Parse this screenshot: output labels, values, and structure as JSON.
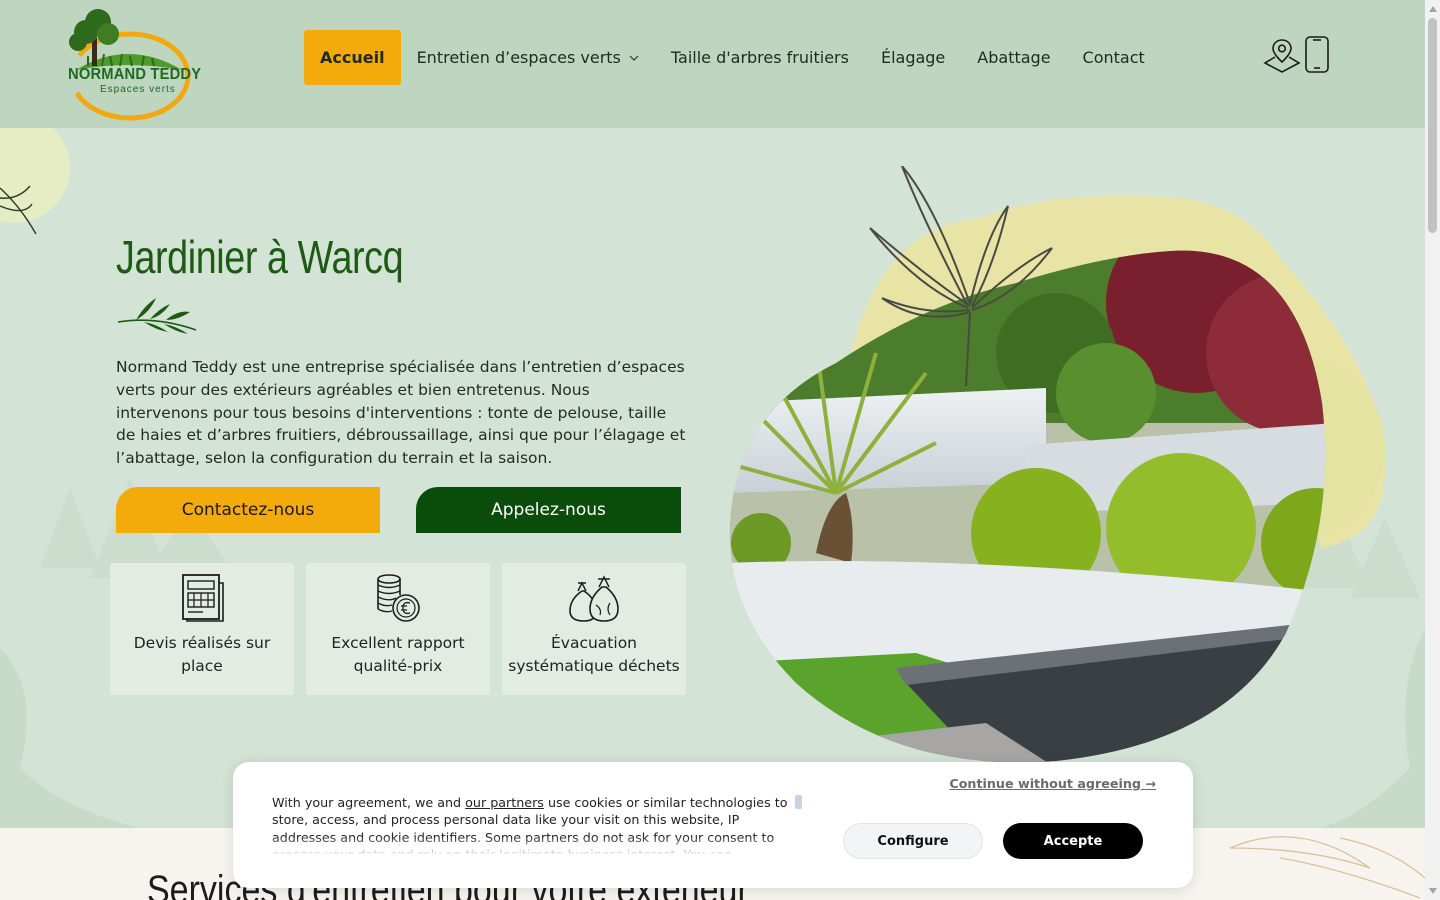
{
  "brand": {
    "name": "NORMAND TEDDY",
    "tagline": "Espaces verts"
  },
  "nav": {
    "items": [
      {
        "label": "Accueil",
        "active": true
      },
      {
        "label": "Entretien d’espaces verts",
        "has_dropdown": true
      },
      {
        "label": "Taille d'arbres fruitiers"
      },
      {
        "label": "Élagage"
      },
      {
        "label": "Abattage"
      },
      {
        "label": "Contact"
      }
    ],
    "icons": [
      "location-icon",
      "phone-icon"
    ]
  },
  "hero": {
    "title": "Jardinier à Warcq",
    "description": "Normand Teddy est une entreprise spécialisée dans l’entretien d’espaces verts pour des extérieurs agréables et bien entretenus. Nous intervenons pour tous besoins d'interventions : tonte de pelouse, taille de haies et d’arbres fruitiers, débroussaillage, ainsi que pour l’élagage et l’abattage, selon la configuration du terrain et la saison.",
    "cta_primary": "Contactez-nous",
    "cta_secondary": "Appelez-nous",
    "features": [
      {
        "icon": "quote-document-icon",
        "label": "Devis réalisés sur place"
      },
      {
        "icon": "coins-euro-icon",
        "label": "Excellent rapport qualité-prix"
      },
      {
        "icon": "waste-bags-icon",
        "label": "Évacuation systématique déchets"
      }
    ]
  },
  "section2": {
    "title": "Services d'entretien pour votre extérieur"
  },
  "cookie": {
    "text_before_link": "With your agreement, we and ",
    "link": "our partners",
    "text_after_link": " use cookies or similar technologies to store, access, and process personal data like your visit on this website, IP addresses and cookie identifiers. Some partners do not ask for your consent to process your data and rely on their legitimate business interest. You can",
    "continue": "Continue without agreeing →",
    "configure": "Configure",
    "accept": "Accepte"
  },
  "colors": {
    "header_bg": "#bed6c0",
    "page_bg": "#d3e3d5",
    "accent_yellow": "#f3ab0c",
    "dark_green": "#0a4d0a",
    "title_green": "#1d5a14"
  }
}
